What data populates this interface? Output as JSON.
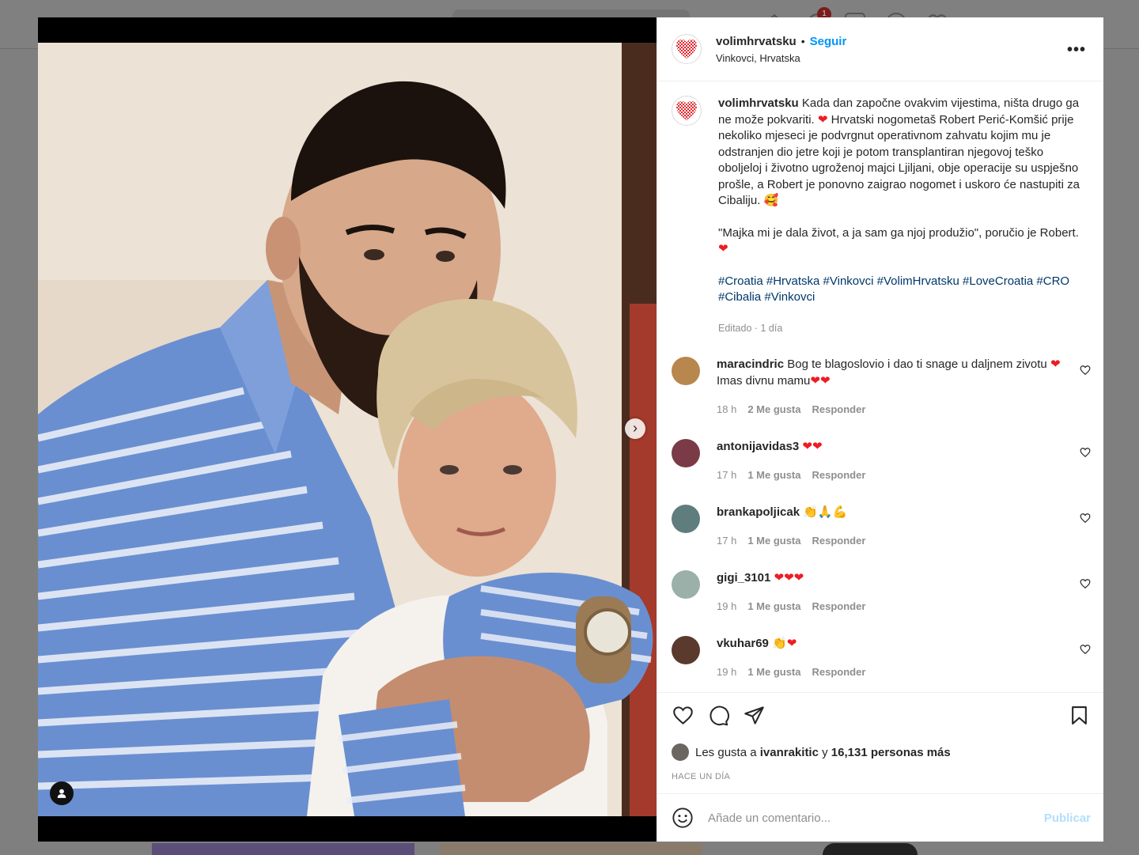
{
  "background": {
    "notification_count": "1"
  },
  "post": {
    "author": "volimhrvatsku",
    "separator": "•",
    "follow_label": "Seguir",
    "location": "Vinkovci, Hrvatska",
    "more_label": "•••",
    "caption": {
      "text1": "Kada dan započne ovakvim vijestima, ništa drugo ga ne može pokvariti.",
      "text2": "Hrvatski nogometaš Robert Perić-Komšić prije nekoliko mjeseci je podvrgnut operativnom zahvatu kojim mu je odstranjen dio jetre koji je potom transplantiran njegovoj teško oboljeloj i životno ugroženoj majci Ljiljani, obje operacije su uspješno prošle, a Robert je ponovno zaigrao nogomet i uskoro će nastupiti za Cibaliju.",
      "text3": "\"Majka mi je dala život, a ja sam ga njoj produžio\", poručio je Robert.",
      "hashtags": "#Croatia #Hrvatska #Vinkovci #VolimHrvatsku #LoveCroatia #CRO #Cibalia #Vinkovci",
      "meta": "Editado · 1 día"
    },
    "comments": [
      {
        "user": "maracindric",
        "text": "Bog te blagoslovio i dao ti snage u daljnem zivotu",
        "text2": "Imas divnu mamu",
        "emojis": "❤️",
        "time": "18 h",
        "likes": "2 Me gusta",
        "reply": "Responder",
        "avatar_color": "#b8874d"
      },
      {
        "user": "antonijavidas3",
        "text": "",
        "emojis": "❤️❤️",
        "time": "17 h",
        "likes": "1 Me gusta",
        "reply": "Responder",
        "avatar_color": "#7a3b46"
      },
      {
        "user": "brankapoljicak",
        "text": "",
        "emojis": "👏🙏💪",
        "time": "17 h",
        "likes": "1 Me gusta",
        "reply": "Responder",
        "avatar_color": "#5f7d7c"
      },
      {
        "user": "gigi_3101",
        "text": "",
        "emojis": "❤️❤️❤️",
        "time": "19 h",
        "likes": "1 Me gusta",
        "reply": "Responder",
        "avatar_color": "#9ab0a8"
      },
      {
        "user": "vkuhar69",
        "text": "",
        "emojis": "👏❤️",
        "time": "19 h",
        "likes": "1 Me gusta",
        "reply": "Responder",
        "avatar_color": "#5a3a2c"
      }
    ],
    "likes": {
      "prefix": "Les gusta a",
      "user": "ivanrakitic",
      "connector": "y",
      "count": "16,131 personas más"
    },
    "timestamp": "HACE UN DÍA",
    "add_comment_placeholder": "Añade un comentario...",
    "publish_label": "Publicar"
  },
  "icons": {
    "like": "heart-icon",
    "comment": "comment-icon",
    "share": "share-icon",
    "save": "bookmark-icon",
    "emoji": "emoji-icon",
    "next": "chevron-right-icon",
    "tag": "user-tag-icon"
  },
  "colors": {
    "accent": "#0095f6",
    "hashtag": "#00376b",
    "muted": "#8e8e8e",
    "heart": "#ed1c24"
  }
}
